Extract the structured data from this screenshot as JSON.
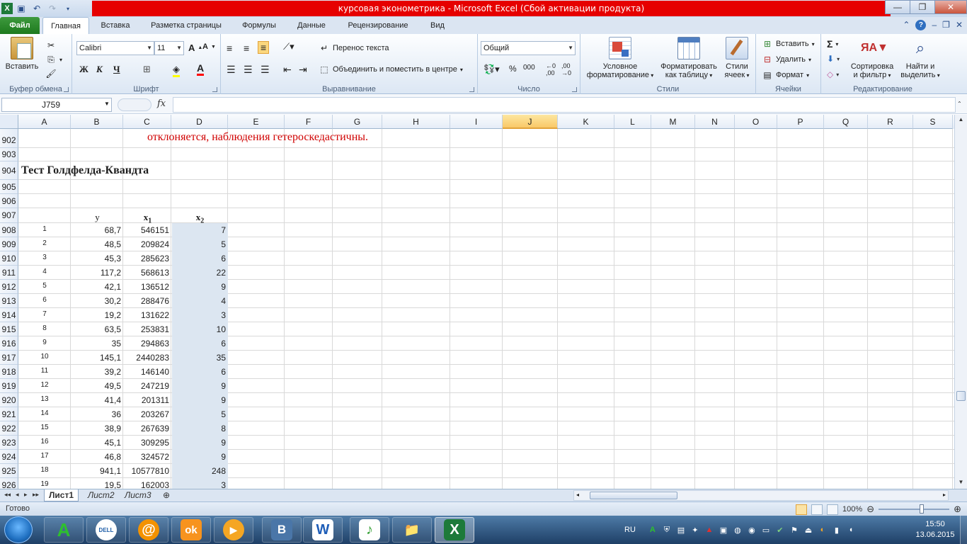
{
  "window": {
    "title": "курсовая эконометрика  -  Microsoft Excel (Сбой активации продукта)",
    "controls": [
      "minimize",
      "maximize",
      "close"
    ]
  },
  "qat": {
    "icons": [
      "excel-icon",
      "save-icon",
      "undo-icon",
      "redo-icon",
      "customize-icon"
    ]
  },
  "ribbon": {
    "file_tab": "Файл",
    "tabs": [
      "Главная",
      "Вставка",
      "Разметка страницы",
      "Формулы",
      "Данные",
      "Рецензирование",
      "Вид"
    ],
    "active_tab": "Главная",
    "groups": {
      "clipboard": {
        "label": "Буфер обмена",
        "paste": "Вставить"
      },
      "font": {
        "label": "Шрифт",
        "font_name": "Calibri",
        "font_size": "11",
        "bold": "Ж",
        "italic": "К",
        "underline": "Ч"
      },
      "alignment": {
        "label": "Выравнивание",
        "wrap": "Перенос текста",
        "merge": "Объединить и поместить в центре"
      },
      "number": {
        "label": "Число",
        "format": "Общий",
        "percent": "%",
        "thousands": "000"
      },
      "styles": {
        "label": "Стили",
        "conditional_1": "Условное",
        "conditional_2": "форматирование",
        "table_1": "Форматировать",
        "table_2": "как таблицу",
        "cell_1": "Стили",
        "cell_2": "ячеек"
      },
      "cells": {
        "label": "Ячейки",
        "insert": "Вставить",
        "delete": "Удалить",
        "format": "Формат"
      },
      "editing": {
        "label": "Редактирование",
        "sort_1": "Сортировка",
        "sort_2": "и фильтр",
        "find_1": "Найти и",
        "find_2": "выделить"
      }
    }
  },
  "formula_bar": {
    "name_box": "J759",
    "fx": "fx",
    "value": ""
  },
  "grid": {
    "columns": [
      "A",
      "B",
      "C",
      "D",
      "E",
      "F",
      "G",
      "H",
      "I",
      "J",
      "K",
      "L",
      "M",
      "N",
      "O",
      "P",
      "Q",
      "R",
      "S"
    ],
    "selected_column": "J",
    "rows": [
      "902",
      "903",
      "904",
      "905",
      "906",
      "907",
      "908",
      "909",
      "910",
      "911",
      "912",
      "913",
      "914",
      "915",
      "916",
      "917",
      "918",
      "919",
      "920",
      "921",
      "922",
      "923",
      "924",
      "925",
      "926"
    ],
    "red_text": "отклоняется, наблюдения гетероскедастичны.",
    "section_title": "Тест Голдфелда-Квандта",
    "var_headers": {
      "y": "y",
      "x1": "x",
      "x1_sub": "1",
      "x2": "x",
      "x2_sub": "2"
    },
    "data": [
      {
        "n": "1",
        "y": "68,7",
        "x1": "546151",
        "x2": "7"
      },
      {
        "n": "2",
        "y": "48,5",
        "x1": "209824",
        "x2": "5"
      },
      {
        "n": "3",
        "y": "45,3",
        "x1": "285623",
        "x2": "6"
      },
      {
        "n": "4",
        "y": "117,2",
        "x1": "568613",
        "x2": "22"
      },
      {
        "n": "5",
        "y": "42,1",
        "x1": "136512",
        "x2": "9"
      },
      {
        "n": "6",
        "y": "30,2",
        "x1": "288476",
        "x2": "4"
      },
      {
        "n": "7",
        "y": "19,2",
        "x1": "131622",
        "x2": "3"
      },
      {
        "n": "8",
        "y": "63,5",
        "x1": "253831",
        "x2": "10"
      },
      {
        "n": "9",
        "y": "35",
        "x1": "294863",
        "x2": "6"
      },
      {
        "n": "10",
        "y": "145,1",
        "x1": "2440283",
        "x2": "35"
      },
      {
        "n": "11",
        "y": "39,2",
        "x1": "146140",
        "x2": "6"
      },
      {
        "n": "12",
        "y": "49,5",
        "x1": "247219",
        "x2": "9"
      },
      {
        "n": "13",
        "y": "41,4",
        "x1": "201311",
        "x2": "9"
      },
      {
        "n": "14",
        "y": "36",
        "x1": "203267",
        "x2": "5"
      },
      {
        "n": "15",
        "y": "38,9",
        "x1": "267639",
        "x2": "8"
      },
      {
        "n": "16",
        "y": "45,1",
        "x1": "309295",
        "x2": "9"
      },
      {
        "n": "17",
        "y": "46,8",
        "x1": "324572",
        "x2": "9"
      },
      {
        "n": "18",
        "y": "941,1",
        "x1": "10577810",
        "x2": "248"
      },
      {
        "n": "19",
        "y": "19,5",
        "x1": "162003",
        "x2": "3"
      }
    ]
  },
  "sheets": {
    "tabs": [
      "Лист1",
      "Лист2",
      "Лист3"
    ],
    "active": "Лист1"
  },
  "status": {
    "ready": "Готово",
    "zoom": "100%"
  },
  "taskbar": {
    "apps": [
      "A",
      "DELL",
      "@",
      "ok",
      "▶",
      "B",
      "W",
      "♪",
      "📁",
      "X"
    ],
    "lang": "RU",
    "time": "15:50",
    "date": "13.06.2015"
  }
}
